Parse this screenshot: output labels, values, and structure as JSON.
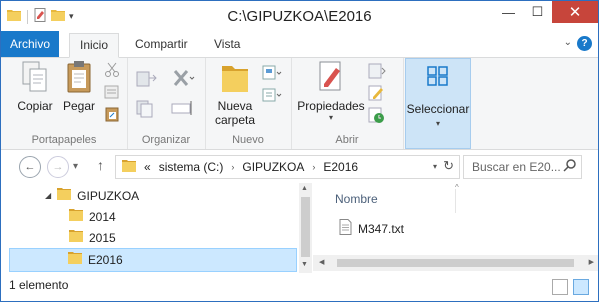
{
  "window": {
    "title": "C:\\GIPUZKOA\\E2016",
    "controls": {
      "minimize": "—",
      "maximize": "☐",
      "close": "✕"
    }
  },
  "ribbon_tabs": {
    "file": "Archivo",
    "home": "Inicio",
    "share": "Compartir",
    "view": "Vista",
    "help": "?"
  },
  "ribbon": {
    "portapapeles": {
      "copy": "Copiar",
      "paste": "Pegar",
      "label": "Portapapeles"
    },
    "organizar": {
      "label": "Organizar"
    },
    "nuevo": {
      "new_folder_l1": "Nueva",
      "new_folder_l2": "carpeta",
      "label": "Nuevo"
    },
    "abrir": {
      "properties": "Propiedades",
      "label": "Abrir"
    },
    "seleccionar": {
      "label": "Seleccionar"
    }
  },
  "address": {
    "prefix": "«",
    "crumbs": [
      "sistema (C:)",
      "GIPUZKOA",
      "E2016"
    ]
  },
  "search": {
    "placeholder": "Buscar en E20..."
  },
  "tree": {
    "items": [
      {
        "label": "GIPUZKOA",
        "expanded": true
      },
      {
        "label": "2014"
      },
      {
        "label": "2015"
      },
      {
        "label": "E2016",
        "selected": true
      }
    ]
  },
  "content": {
    "column_name": "Nombre",
    "files": [
      {
        "name": "M347.txt"
      }
    ]
  },
  "status": {
    "text": "1 elemento"
  },
  "colors": {
    "accent": "#1979ca",
    "selection": "#cce8ff",
    "close": "#c7453b",
    "folder": "#e8b83c"
  }
}
